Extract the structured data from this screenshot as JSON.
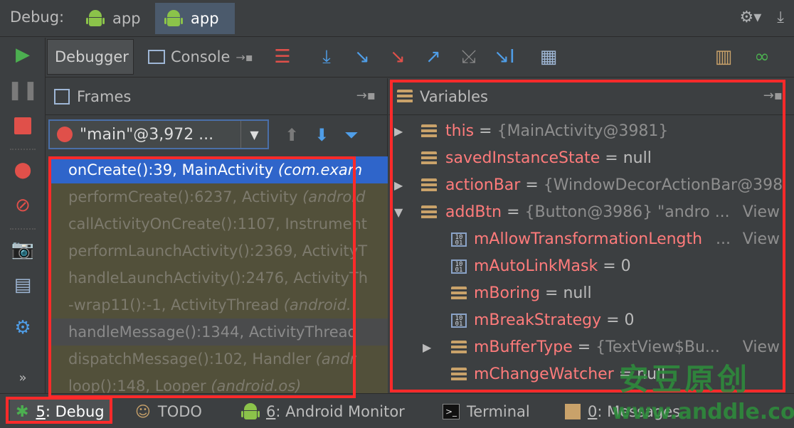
{
  "topbar": {
    "label": "Debug:",
    "tabs": [
      {
        "label": "app"
      },
      {
        "label": "app"
      }
    ]
  },
  "subtabs": {
    "debugger": "Debugger",
    "console": "Console"
  },
  "frames": {
    "title": "Frames",
    "thread": "\"main\"@3,972 ...",
    "rows": [
      {
        "method": "onCreate():39, MainActivity ",
        "pkg": "(com.exam"
      },
      {
        "method": "performCreate():6237, Activity ",
        "pkg": "(android"
      },
      {
        "method": "callActivityOnCreate():1107, Instrument",
        "pkg": ""
      },
      {
        "method": "performLaunchActivity():2369, ActivityT",
        "pkg": ""
      },
      {
        "method": "handleLaunchActivity():2476, ActivityTh",
        "pkg": ""
      },
      {
        "method": "-wrap11():-1, ActivityThread ",
        "pkg": "(android."
      },
      {
        "method": "handleMessage():1344, ActivityThread",
        "pkg": ""
      },
      {
        "method": "dispatchMessage():102, Handler ",
        "pkg": "(andr"
      },
      {
        "method": "loop():148, Looper ",
        "pkg": "(android.os)"
      }
    ]
  },
  "variables": {
    "title": "Variables",
    "rows": [
      {
        "name": "this",
        "value": " = ",
        "detail": "{MainActivity@3981}",
        "view": ""
      },
      {
        "name": "savedInstanceState",
        "value": " = null",
        "detail": "",
        "view": ""
      },
      {
        "name": "actionBar",
        "value": " = ",
        "detail": "{WindowDecorActionBar@398",
        "view": ""
      },
      {
        "name": "addBtn",
        "value": " = ",
        "detail": "{Button@3986} \"andro ...",
        "view": "View"
      },
      {
        "name": "mAllowTransformationLength",
        "value": "",
        "detail": "...",
        "view": "View"
      },
      {
        "name": "mAutoLinkMask",
        "value": " = 0",
        "detail": "",
        "view": ""
      },
      {
        "name": "mBoring",
        "value": " = null",
        "detail": "",
        "view": ""
      },
      {
        "name": "mBreakStrategy",
        "value": " = 0",
        "detail": "",
        "view": ""
      },
      {
        "name": "mBufferType",
        "value": " = ",
        "detail": "{TextView$Bu...",
        "view": "View"
      },
      {
        "name": "mChangeWatcher",
        "value": " = null",
        "detail": "",
        "view": ""
      }
    ]
  },
  "bottombar": {
    "debug_num": "5",
    "debug_label": ": Debug",
    "todo": "TODO",
    "monitor_num": "6",
    "monitor_label": ": Android Monitor",
    "terminal": "Terminal",
    "messages_num": "0",
    "messages_label": ": Messages"
  },
  "watermark": {
    "cn": "安豆原创",
    "url": "www.anddle.com"
  },
  "colors": {
    "accent_selection": "#2f65ca",
    "annotation_red": "#ff2a2a",
    "variable_name": "#ff7b7b"
  }
}
